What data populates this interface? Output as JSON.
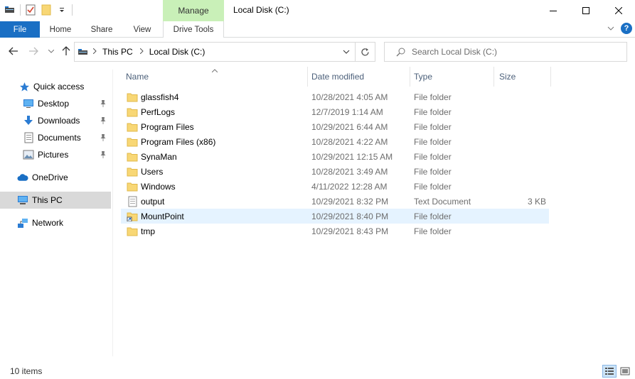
{
  "window": {
    "title": "Local Disk (C:)",
    "context_tab": "Manage",
    "controls": {
      "minimize": "—",
      "maximize": "☐",
      "close": "✕"
    }
  },
  "ribbon": {
    "tabs": [
      "File",
      "Home",
      "Share",
      "View",
      "Drive Tools"
    ],
    "file_color": "#1a6fc4",
    "manage_color": "#c9f0b8",
    "help_label": "?"
  },
  "address": {
    "crumbs": [
      "This PC",
      "Local Disk (C:)"
    ],
    "search_placeholder": "Search Local Disk (C:)"
  },
  "nav": {
    "quick_access": "Quick access",
    "pinned": [
      {
        "label": "Desktop",
        "icon": "desktop-icon"
      },
      {
        "label": "Downloads",
        "icon": "downloads-icon"
      },
      {
        "label": "Documents",
        "icon": "documents-icon"
      },
      {
        "label": "Pictures",
        "icon": "pictures-icon"
      }
    ],
    "onedrive": "OneDrive",
    "this_pc": "This PC",
    "network": "Network"
  },
  "columns": {
    "name": "Name",
    "date": "Date modified",
    "type": "Type",
    "size": "Size"
  },
  "files": [
    {
      "name": "glassfish4",
      "date": "10/28/2021 4:05 AM",
      "type": "File folder",
      "size": "",
      "icon": "folder"
    },
    {
      "name": "PerfLogs",
      "date": "12/7/2019 1:14 AM",
      "type": "File folder",
      "size": "",
      "icon": "folder"
    },
    {
      "name": "Program Files",
      "date": "10/29/2021 6:44 AM",
      "type": "File folder",
      "size": "",
      "icon": "folder"
    },
    {
      "name": "Program Files (x86)",
      "date": "10/28/2021 4:22 AM",
      "type": "File folder",
      "size": "",
      "icon": "folder"
    },
    {
      "name": "SynaMan",
      "date": "10/29/2021 12:15 AM",
      "type": "File folder",
      "size": "",
      "icon": "folder"
    },
    {
      "name": "Users",
      "date": "10/28/2021 3:49 AM",
      "type": "File folder",
      "size": "",
      "icon": "folder"
    },
    {
      "name": "Windows",
      "date": "4/11/2022 12:28 AM",
      "type": "File folder",
      "size": "",
      "icon": "folder"
    },
    {
      "name": "output",
      "date": "10/29/2021 8:32 PM",
      "type": "Text Document",
      "size": "3 KB",
      "icon": "text"
    },
    {
      "name": "MountPoint",
      "date": "10/29/2021 8:40 PM",
      "type": "File folder",
      "size": "",
      "icon": "mount"
    },
    {
      "name": "tmp",
      "date": "10/29/2021 8:43 PM",
      "type": "File folder",
      "size": "",
      "icon": "folder"
    }
  ],
  "selected_index": 8,
  "status": {
    "count": "10 items"
  }
}
